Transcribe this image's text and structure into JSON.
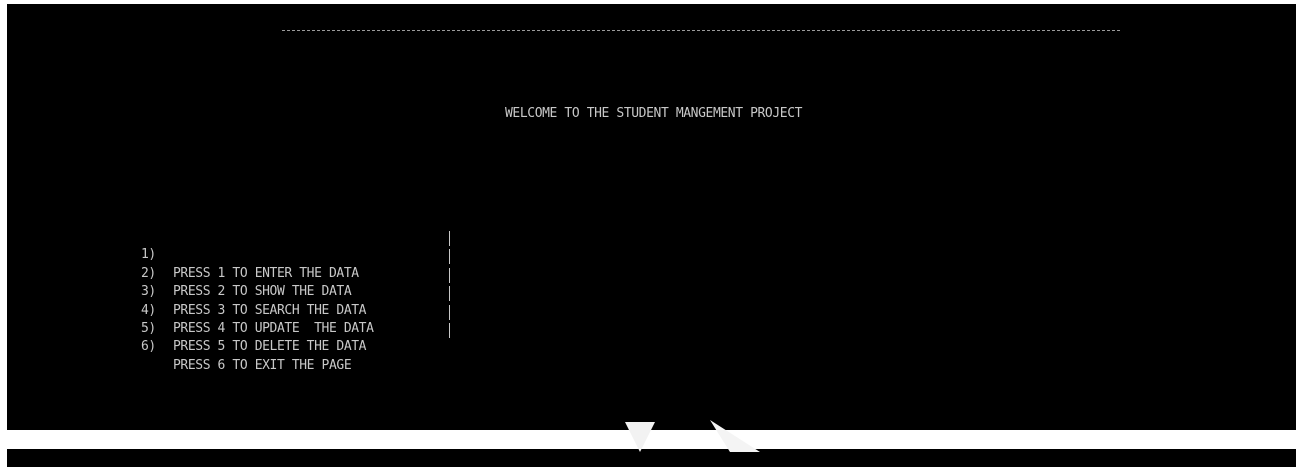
{
  "header": {
    "divider_text": "-----------------------------------------------------------------------------------------------------------------------------------------------------------"
  },
  "welcome": {
    "title": "WELCOME TO THE STUDENT MANGEMENT PROJECT"
  },
  "menu": {
    "items": [
      {
        "number": "1)",
        "label": "PRESS 1 TO ENTER THE DATA"
      },
      {
        "number": "2)",
        "label": "PRESS 2 TO SHOW THE DATA"
      },
      {
        "number": "3)",
        "label": "PRESS 3 TO SEARCH THE DATA"
      },
      {
        "number": "4)",
        "label": "PRESS 4 TO UPDATE  THE DATA"
      },
      {
        "number": "5)",
        "label": "PRESS 5 TO DELETE THE DATA"
      },
      {
        "number": "6)",
        "label": "PRESS 6 TO EXIT THE PAGE"
      }
    ]
  },
  "colors": {
    "console_background": "#000000",
    "console_text": "#c8c8c8",
    "page_background": "#ffffff"
  }
}
